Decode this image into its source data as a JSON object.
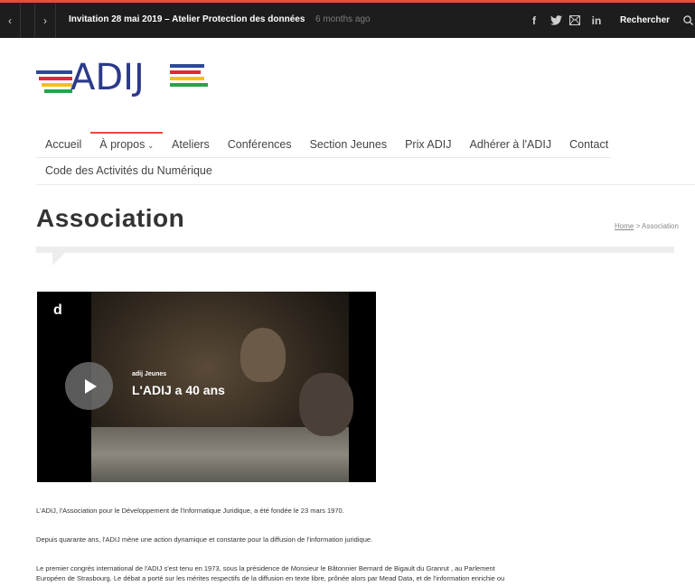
{
  "topbar": {
    "prev_icon": "chevron-left-icon",
    "next_icon": "chevron-right-icon",
    "headline": "Invitation 28 mai 2019 – Atelier Protection des données",
    "time_ago": "6 months ago",
    "social_icons": [
      "facebook-icon",
      "twitter-icon",
      "email-icon",
      "linkedin-icon"
    ],
    "search_placeholder": "Rechercher",
    "search_icon": "search-icon"
  },
  "logo": {
    "text": "ADIJ",
    "colors": [
      "#2b4a9b",
      "#e8262b",
      "#f3c01a",
      "#2aa24a"
    ]
  },
  "menu": {
    "row1": [
      {
        "label": "Accueil"
      },
      {
        "label": "À propos",
        "active": true,
        "dropdown": true
      },
      {
        "label": "Ateliers"
      },
      {
        "label": "Conférences"
      },
      {
        "label": "Section Jeunes"
      },
      {
        "label": "Prix ADIJ"
      },
      {
        "label": "Adhérer à l'ADIJ"
      },
      {
        "label": "Contact"
      }
    ],
    "row2": [
      {
        "label": "Code des Activités du Numérique"
      }
    ]
  },
  "page": {
    "title": "Association",
    "breadcrumb_home": "Home",
    "breadcrumb_sep": ">",
    "breadcrumb_current": "Association"
  },
  "video": {
    "brand": "d",
    "channel": "adij Jeunes",
    "title": "L'ADIJ a 40 ans"
  },
  "content": {
    "p1": "L'ADIJ, l'Association pour le Développement de l'Informatique Juridique, a été fondée le 23 mars 1970.",
    "p2": "Depuis quarante ans, l'ADIJ mène une action dynamique et constante pour la diffusion de l'information juridique.",
    "p3_line1": "Le premier congrès international de l'ADIJ s'est tenu en 1973, sous la présidence de Monsieur le Bâtonnier Bernard de Bigault du Granrut , au Parlement",
    "p3_line2": "Européen de Strasbourg. Le débat a porté sur les mérites respectifs de la diffusion en texte libre, prônée alors par Mead Data, et de l'information enrichie ou"
  },
  "colors": {
    "accent": "#e84c3d",
    "topbar": "#1d1d1d",
    "logo_text": "#2c3a8a"
  }
}
